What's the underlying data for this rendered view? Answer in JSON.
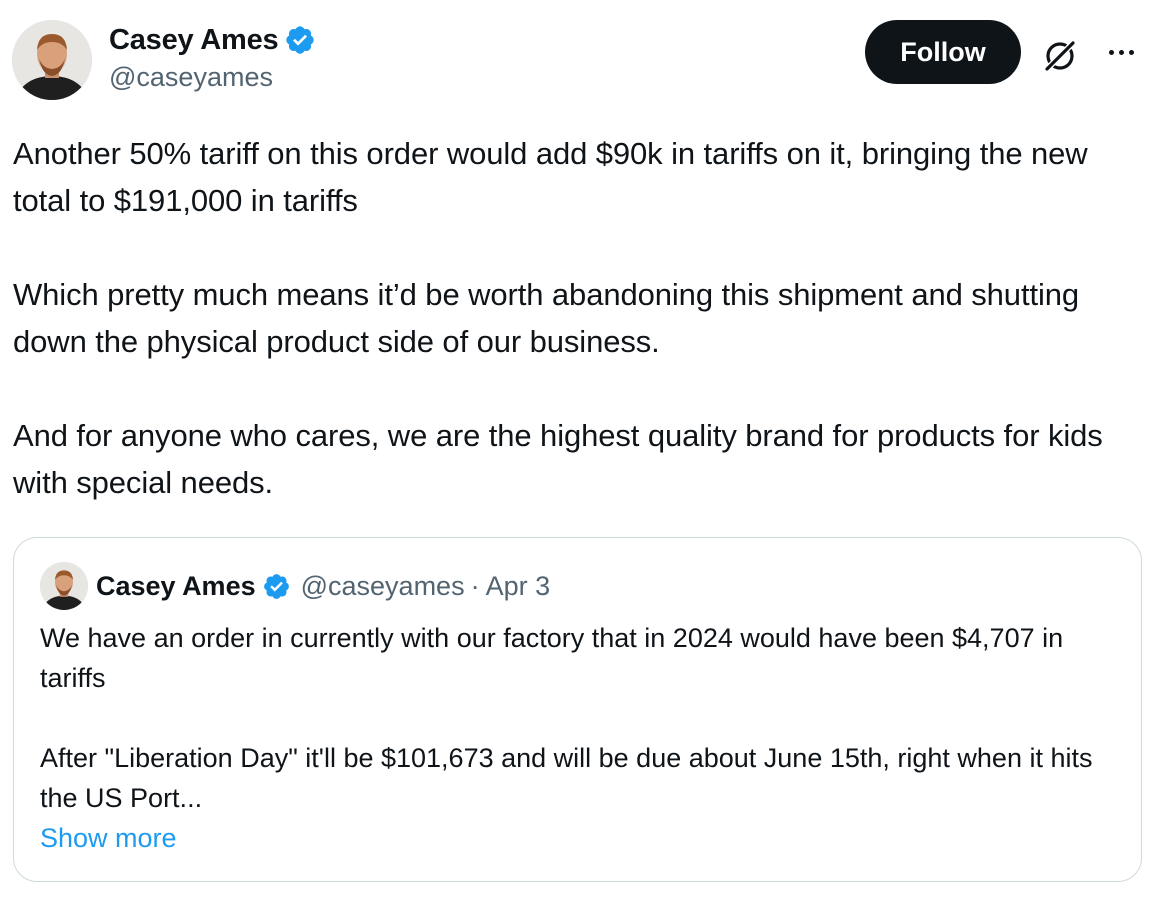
{
  "author": {
    "display_name": "Casey Ames",
    "handle": "@caseyames",
    "verified_icon": "verified-badge-icon",
    "avatar_icon": "profile-avatar"
  },
  "actions": {
    "follow_label": "Follow",
    "grok_icon": "grok-icon",
    "more_icon": "more-options-icon"
  },
  "tweet": {
    "paragraphs": [
      "Another 50% tariff on this order would add $90k in tariffs on it, bringing the new total to $191,000 in tariffs",
      "Which pretty much means it’d be worth abandoning this shipment and shutting down the physical product side of our business.",
      "And for anyone who cares, we are the highest quality brand for products for kids with special needs."
    ]
  },
  "quote": {
    "display_name": "Casey Ames",
    "handle": "@caseyames",
    "separator": "·",
    "date": "Apr 3",
    "paragraphs": [
      "We have an order in currently with our factory that in 2024 would have been $4,707 in tariffs",
      "After \"Liberation Day\" it'll be $101,673 and will be due about June 15th, right when it hits the US Port..."
    ],
    "show_more_label": "Show more"
  },
  "colors": {
    "text_primary": "#0f1419",
    "text_secondary": "#536471",
    "link": "#1d9bf0",
    "verified": "#1d9bf0",
    "border": "#cfd9de"
  }
}
